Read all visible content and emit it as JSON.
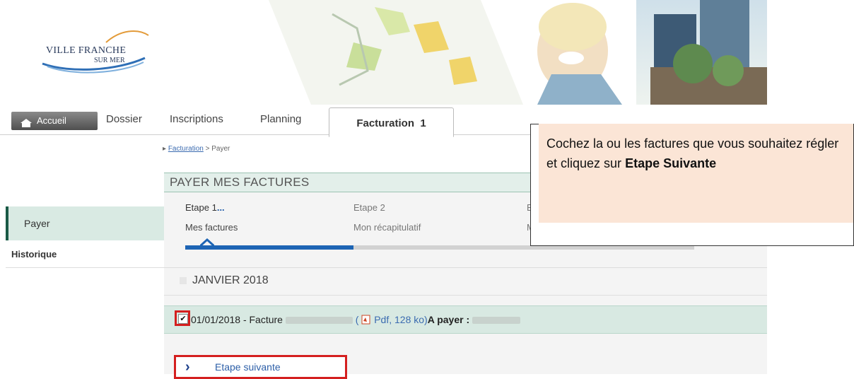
{
  "brand": {
    "logo_line1": "VILLE FRANCHE",
    "logo_line2": "SUR MER"
  },
  "nav": {
    "home": "Accueil",
    "tabs": [
      "Dossier",
      "Inscriptions",
      "Planning"
    ],
    "active_tab": "Facturation",
    "active_tab_badge": "1"
  },
  "breadcrumb": {
    "root": "Facturation",
    "separator": ">",
    "current": "Payer"
  },
  "sidebar": {
    "items": [
      {
        "label": "Payer",
        "active": true
      },
      {
        "label": "Historique",
        "active": false
      }
    ]
  },
  "panel": {
    "title": "PAYER MES FACTURES",
    "steps": [
      {
        "title": "Etape 1",
        "subtitle": "Mes factures",
        "current": true,
        "indicator": "..."
      },
      {
        "title": "Etape 2",
        "subtitle": "Mon récapitulatif",
        "current": false
      },
      {
        "title": "E",
        "subtitle": "M",
        "current": false
      }
    ],
    "progress": 0.33,
    "month": "JANVIER 2018",
    "invoice": {
      "date_label": "01/01/2018 - Facture",
      "checked": true,
      "pdf_label": "Pdf, 128 ko",
      "open_paren": "(",
      "close_paren": ")",
      "due_label": "A payer :"
    },
    "next_button": "Etape suivante"
  },
  "callout": {
    "text": "Cochez la ou les factures que vous souhaitez régler et cliquez sur",
    "emphasis": "Etape Suivante",
    "bg_color": "#fbe5d6"
  },
  "colors": {
    "accent_blue": "#1d64b4",
    "highlight_red": "#d41f1f",
    "panel_green": "#d8e9e2"
  }
}
